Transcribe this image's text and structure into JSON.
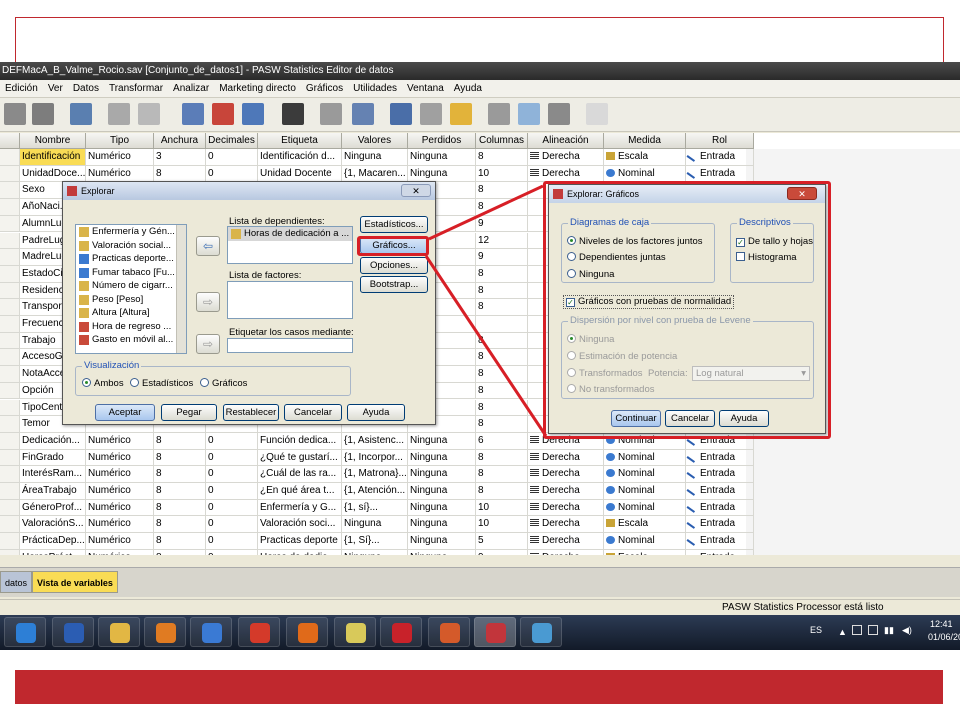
{
  "window_title": "DEFMacA_B_Valme_Rocio.sav [Conjunto_de_datos1] - PASW Statistics Editor de datos",
  "menu": [
    "Edición",
    "Ver",
    "Datos",
    "Transformar",
    "Analizar",
    "Marketing directo",
    "Gráficos",
    "Utilidades",
    "Ventana",
    "Ayuda"
  ],
  "columns": [
    "Nombre",
    "Tipo",
    "Anchura",
    "Decimales",
    "Etiqueta",
    "Valores",
    "Perdidos",
    "Columnas",
    "Alineación",
    "Medida",
    "Rol"
  ],
  "rows": [
    [
      "Identificación",
      "Numérico",
      "3",
      "0",
      "Identificación d...",
      "Ninguna",
      "Ninguna",
      "8",
      "Derecha",
      "Escala",
      "Entrada"
    ],
    [
      "UnidadDoce...",
      "Numérico",
      "8",
      "0",
      "Unidad Docente",
      "{1, Macaren...",
      "Ninguna",
      "10",
      "Derecha",
      "Nominal",
      "Entrada"
    ],
    [
      "Sexo",
      "",
      "",
      "",
      "",
      "",
      "",
      "8",
      "",
      "",
      ""
    ],
    [
      "AñoNaci...",
      "",
      "",
      "",
      "",
      "",
      "",
      "8",
      "",
      "",
      ""
    ],
    [
      "AlumnLug...",
      "",
      "",
      "",
      "",
      "",
      "",
      "9",
      "",
      "",
      ""
    ],
    [
      "PadreLug...",
      "",
      "",
      "",
      "",
      "",
      "",
      "12",
      "",
      "",
      ""
    ],
    [
      "MadreLug...",
      "",
      "",
      "",
      "",
      "",
      "",
      "9",
      "",
      "",
      ""
    ],
    [
      "EstadoCi...",
      "",
      "",
      "",
      "",
      "",
      "",
      "8",
      "",
      "",
      ""
    ],
    [
      "Residenc...",
      "",
      "",
      "",
      "",
      "",
      "",
      "8",
      "",
      "",
      ""
    ],
    [
      "Transport...",
      "",
      "",
      "",
      "",
      "",
      "",
      "8",
      "",
      "",
      ""
    ],
    [
      "Frecuenc...",
      "",
      "",
      "",
      "",
      "",
      "",
      "",
      "",
      "",
      ""
    ],
    [
      "Trabajo",
      "",
      "",
      "",
      "",
      "",
      "",
      "8",
      "",
      "",
      ""
    ],
    [
      "AccesoG...",
      "",
      "",
      "",
      "",
      "",
      "",
      "8",
      "",
      "",
      ""
    ],
    [
      "NotaAcce...",
      "",
      "",
      "",
      "",
      "",
      "",
      "8",
      "",
      "",
      ""
    ],
    [
      "Opción",
      "",
      "",
      "",
      "",
      "",
      "",
      "8",
      "",
      "",
      ""
    ],
    [
      "TipoCent...",
      "",
      "",
      "",
      "",
      "",
      "",
      "8",
      "",
      "",
      ""
    ],
    [
      "Temor",
      "",
      "",
      "",
      "",
      "",
      "",
      "8",
      "",
      "",
      ""
    ],
    [
      "Dedicación...",
      "Numérico",
      "8",
      "0",
      "Función dedica...",
      "{1, Asistenc...",
      "Ninguna",
      "6",
      "Derecha",
      "Nominal",
      "Entrada"
    ],
    [
      "FinGrado",
      "Numérico",
      "8",
      "0",
      "¿Qué te gustarí...",
      "{1, Incorpor...",
      "Ninguna",
      "8",
      "Derecha",
      "Nominal",
      "Entrada"
    ],
    [
      "InterésRam...",
      "Numérico",
      "8",
      "0",
      "¿Cuál de las ra...",
      "{1, Matrona}...",
      "Ninguna",
      "8",
      "Derecha",
      "Nominal",
      "Entrada"
    ],
    [
      "ÁreaTrabajo",
      "Numérico",
      "8",
      "0",
      "¿En qué área t...",
      "{1, Atención...",
      "Ninguna",
      "8",
      "Derecha",
      "Nominal",
      "Entrada"
    ],
    [
      "GéneroProf...",
      "Numérico",
      "8",
      "0",
      "Enfermería y G...",
      "{1, sí}...",
      "Ninguna",
      "10",
      "Derecha",
      "Nominal",
      "Entrada"
    ],
    [
      "ValoraciónS...",
      "Numérico",
      "8",
      "0",
      "Valoración soci...",
      "Ninguna",
      "Ninguna",
      "10",
      "Derecha",
      "Escala",
      "Entrada"
    ],
    [
      "PrácticaDep...",
      "Numérico",
      "8",
      "0",
      "Practicas deporte",
      "{1, Sí}...",
      "Ninguna",
      "5",
      "Derecha",
      "Nominal",
      "Entrada"
    ],
    [
      "HorasPráct...",
      "Numérico",
      "8",
      "0",
      "Horas de dedic...",
      "Ninguna",
      "Ninguna",
      "9",
      "Derecha",
      "Escala",
      "Entrada"
    ]
  ],
  "tabs": {
    "data": "datos",
    "variables": "Vista de variables"
  },
  "status": "PASW Statistics Processor está listo",
  "explorar": {
    "title": "Explorar",
    "variables": [
      "Enfermería y Gén...",
      "Valoración social...",
      "Practicas deporte...",
      "Fumar tabaco [Fu...",
      "Número de cigarr...",
      "Peso [Peso]",
      "Altura [Altura]",
      "Hora de regreso ...",
      "Gasto en móvil al..."
    ],
    "dependents_label": "Lista de dependientes:",
    "dependents": [
      "Horas de dedicación a ..."
    ],
    "factors_label": "Lista de factores:",
    "label_cases": "Etiquetar los casos mediante:",
    "side_buttons": [
      "Estadísticos...",
      "Gráficos...",
      "Opciones...",
      "Bootstrap..."
    ],
    "display_label": "Visualización",
    "display_opts": [
      "Ambos",
      "Estadísticos",
      "Gráficos"
    ],
    "bottom_buttons": [
      "Aceptar",
      "Pegar",
      "Restablecer",
      "Cancelar",
      "Ayuda"
    ]
  },
  "graficos": {
    "title": "Explorar: Gráficos",
    "box_label": "Diagramas de caja",
    "box_opts": [
      "Niveles de los factores juntos",
      "Dependientes juntas",
      "Ninguna"
    ],
    "desc_label": "Descriptivos",
    "desc_opts": [
      "De tallo y hojas",
      "Histograma"
    ],
    "normality": "Gráficos con pruebas de normalidad",
    "levene_label": "Dispersión por nivel con prueba de Levene",
    "levene_opts": [
      "Ninguna",
      "Estimación de potencia",
      "Transformados",
      "No transformados"
    ],
    "potencia_label": "Potencia:",
    "potencia_value": "Log natural",
    "buttons": [
      "Continuar",
      "Cancelar",
      "Ayuda"
    ]
  },
  "taskbar": {
    "lang": "ES",
    "time": "12:41",
    "date": "01/06/20"
  }
}
